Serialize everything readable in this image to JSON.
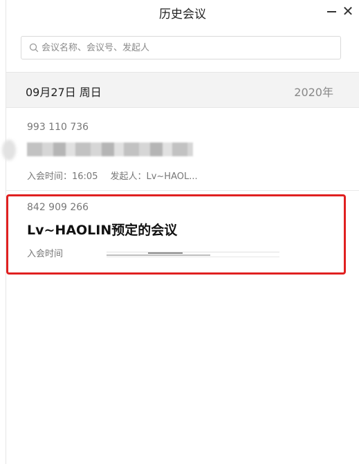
{
  "window": {
    "title": "历史会议"
  },
  "search": {
    "placeholder": "会议名称、会议号、发起人",
    "value": ""
  },
  "date_group": {
    "date": "09月27日 周日",
    "year": "2020年"
  },
  "meetings": [
    {
      "id": "993 110 736",
      "title": "",
      "join_label": "入会时间：16:05",
      "initiator_label": "发起人：Lv~HAOL..."
    },
    {
      "id": "842 909 266",
      "title": "Lv~HAOLIN预定的会议",
      "join_label": "入会时间"
    }
  ],
  "colors": {
    "highlight": "#e02020",
    "date_header_bg": "#f3f3f3"
  }
}
